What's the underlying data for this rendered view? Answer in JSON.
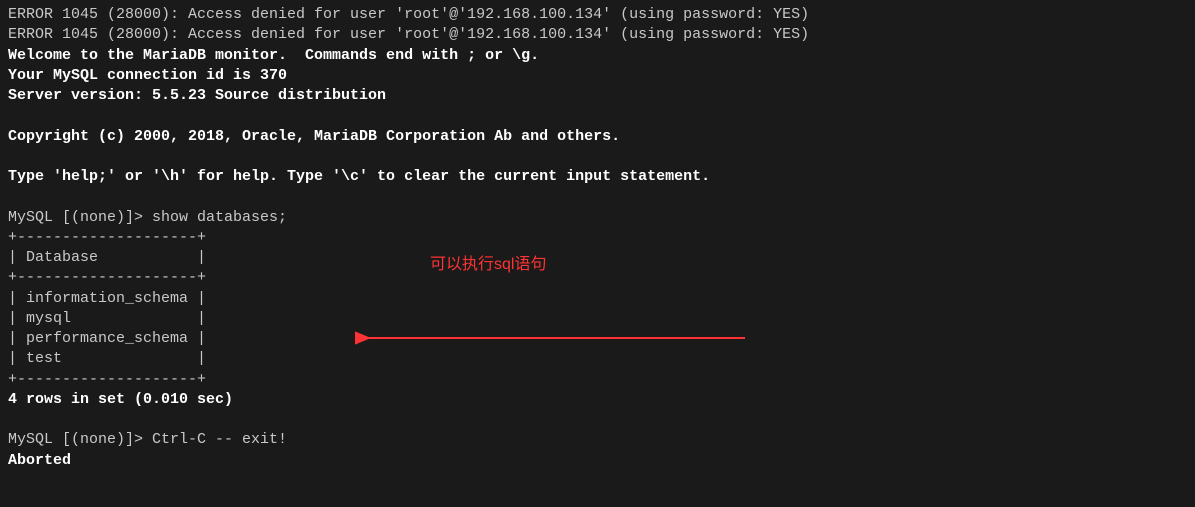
{
  "terminal": {
    "error_line_1": "ERROR 1045 (28000): Access denied for user 'root'@'192.168.100.134' (using password: YES)",
    "error_line_2": "ERROR 1045 (28000): Access denied for user 'root'@'192.168.100.134' (using password: YES)",
    "welcome_line": "Welcome to the MariaDB monitor.  Commands end with ; or \\g.",
    "connection_line": "Your MySQL connection id is 370",
    "server_version_line": "Server version: 5.5.23 Source distribution",
    "copyright_line": "Copyright (c) 2000, 2018, Oracle, MariaDB Corporation Ab and others.",
    "help_line": "Type 'help;' or '\\h' for help. Type '\\c' to clear the current input statement.",
    "prompt_1": "MySQL [(none)]> ",
    "command_1": "show databases;",
    "table_border": "+--------------------+",
    "table_header": "| Database           |",
    "table_row_1": "| information_schema |",
    "table_row_2": "| mysql              |",
    "table_row_3": "| performance_schema |",
    "table_row_4": "| test               |",
    "result_line": "4 rows in set (0.010 sec)",
    "prompt_2": "MySQL [(none)]> ",
    "command_2": "Ctrl-C -- exit!",
    "aborted_line": "Aborted"
  },
  "annotation": {
    "text": "可以执行sql语句"
  }
}
